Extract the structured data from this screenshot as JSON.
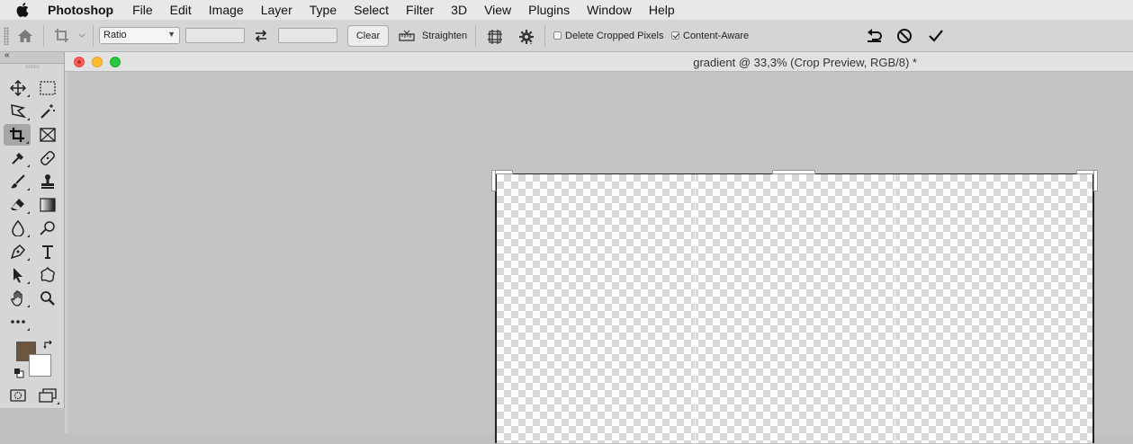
{
  "menu": {
    "apple_icon": "apple-icon",
    "app": "Photoshop",
    "items": [
      "File",
      "Edit",
      "Image",
      "Layer",
      "Type",
      "Select",
      "Filter",
      "3D",
      "View",
      "Plugins",
      "Window",
      "Help"
    ]
  },
  "options": {
    "ratio_value": "Ratio",
    "width_value": "",
    "height_value": "",
    "clear_label": "Clear",
    "straighten_label": "Straighten",
    "delete_cropped_label": "Delete Cropped Pixels",
    "delete_cropped_checked": false,
    "content_aware_label": "Content-Aware",
    "content_aware_checked": true
  },
  "document": {
    "title": "gradient @ 33,3% (Crop Preview, RGB/8) *"
  },
  "colors": {
    "foreground": "#6b5440",
    "background": "#ffffff"
  }
}
